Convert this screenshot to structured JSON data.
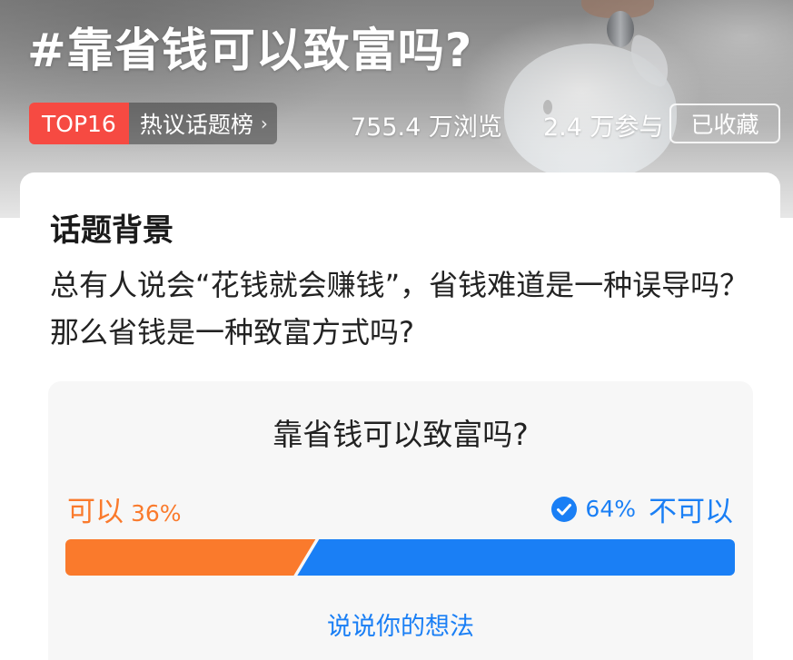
{
  "header": {
    "title": "#靠省钱可以致富吗?",
    "rank_badge": "TOP16",
    "list_label": "热议话题榜",
    "chevron": "›",
    "views": "755.4 万浏览",
    "participants": "2.4 万参与",
    "favorite_button": "已收藏"
  },
  "background": {
    "heading": "话题背景",
    "text": "总有人说会“花钱就会赚钱”，省钱难道是一种误导吗？那么省钱是一种致富方式吗?"
  },
  "poll": {
    "question": "靠省钱可以致富吗?",
    "option_yes": {
      "label": "可以",
      "percent_text": "36%",
      "percent": 36,
      "color": "#fa7a2c"
    },
    "option_no": {
      "label": "不可以",
      "percent_text": "64%",
      "percent": 64,
      "color": "#1a7ff5",
      "selected": true,
      "icon": "check-circle-icon"
    },
    "share_link": "说说你的想法"
  }
}
